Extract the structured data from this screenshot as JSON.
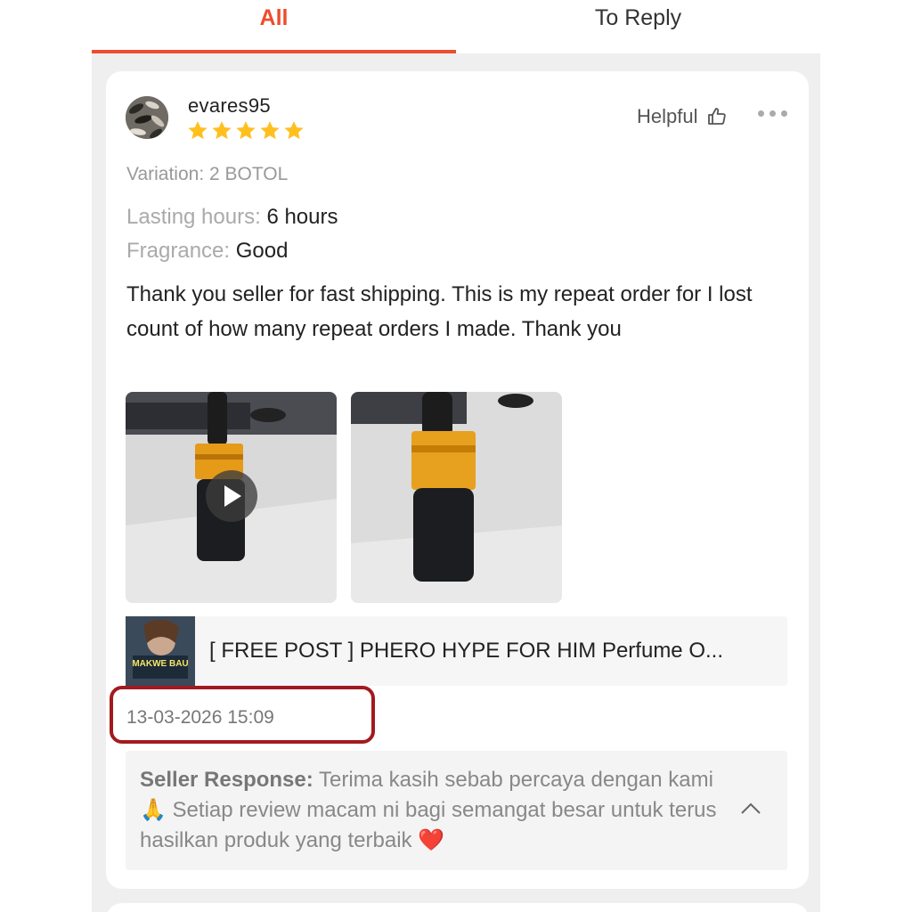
{
  "tabs": [
    {
      "label": "All",
      "active": true
    },
    {
      "label": "To Reply",
      "active": false
    }
  ],
  "review": {
    "username": "evares95",
    "rating": 5,
    "helpful_label": "Helpful",
    "variation": "Variation: 2 BOTOL",
    "attributes": [
      {
        "label": "Lasting hours:",
        "value": "6 hours"
      },
      {
        "label": "Fragrance:",
        "value": "Good"
      }
    ],
    "text": "Thank you seller for fast shipping. This is my repeat order for I lost count of how many repeat orders I made. Thank you",
    "media": [
      {
        "kind": "video",
        "icon": "play-icon"
      },
      {
        "kind": "photo"
      }
    ],
    "product_name": "[ FREE POST ] PHERO HYPE FOR HIM Perfume O...",
    "product_thumb_text": "MAKWE BAU",
    "timestamp": "13-03-2026 15:09",
    "seller_response": {
      "label": "Seller Response:",
      "text": " Terima kasih sebab percaya dengan kami 🙏 Setiap review macam ni bagi semangat besar untuk terus hasilkan produk yang terbaik ❤️"
    }
  },
  "colors": {
    "accent": "#ee4d2d",
    "star": "#ffbf1f",
    "highlight_border": "#a21a1e"
  }
}
